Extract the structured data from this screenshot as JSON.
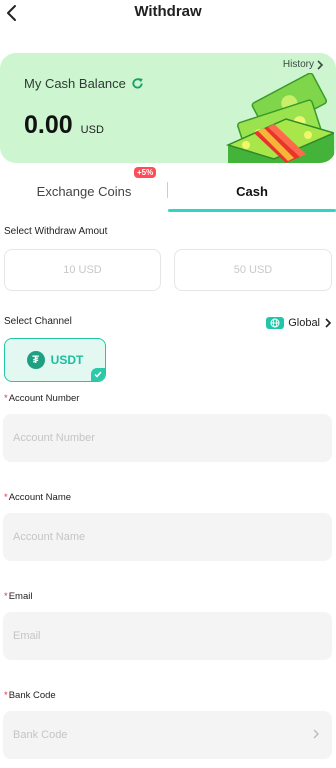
{
  "header": {
    "title": "Withdraw",
    "back_icon": "chevron-left-icon"
  },
  "balance": {
    "history_label": "History",
    "label": "My Cash Balance",
    "value": "0.00",
    "currency": "USD",
    "bg_color": "#ccf5d0"
  },
  "tabs": [
    {
      "label": "Exchange Coins",
      "badge": "+5%",
      "active": false
    },
    {
      "label": "Cash",
      "active": true
    }
  ],
  "amount_section": {
    "label": "Select Withdraw Amout",
    "options": [
      "10 USD",
      "50 USD"
    ]
  },
  "channel_section": {
    "label": "Select Channel",
    "region": "Global",
    "channel": "USDT"
  },
  "form": {
    "account_number": {
      "label": "Account Number",
      "placeholder": "Account Number"
    },
    "account_name": {
      "label": "Account Name",
      "placeholder": "Account Name"
    },
    "email": {
      "label": "Email",
      "placeholder": "Email"
    },
    "bank_code": {
      "label": "Bank Code",
      "placeholder": "Bank Code"
    }
  },
  "colors": {
    "accent": "#2fd6c4",
    "required": "#e8333f",
    "badge": "#ff4d57"
  }
}
